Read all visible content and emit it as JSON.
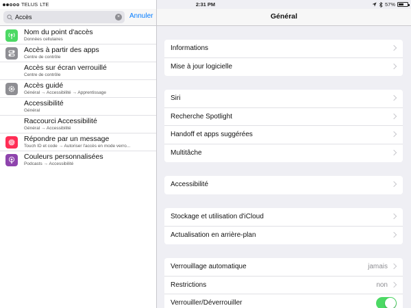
{
  "status": {
    "carrier": "TELUS",
    "network": "LTE",
    "time": "2:31 PM",
    "battery": "57%",
    "battery_level": 0.57
  },
  "search": {
    "value": "Accès",
    "cancel_label": "Annuler",
    "clear_glyph": "×"
  },
  "results": [
    {
      "title": "Nom du point d'accès",
      "subtitle": "Données cellulaires",
      "icon": "hotspot-icon",
      "color": "#4cd964"
    },
    {
      "title": "Accès à partir des apps",
      "subtitle": "Centre de contrôle",
      "icon": "control-center-icon",
      "color": "#8e8e93"
    },
    {
      "title": "Accès sur écran verrouillé",
      "subtitle": "Centre de contrôle",
      "icon": "",
      "color": ""
    },
    {
      "title": "Accès guidé",
      "subtitle": "Général → Accessibilité → Apprentissage",
      "icon": "gear-icon",
      "color": "#8e8e93"
    },
    {
      "title": "Accessibilité",
      "subtitle": "Général",
      "icon": "",
      "color": ""
    },
    {
      "title": "Raccourci Accessibilité",
      "subtitle": "Général → Accessibilité",
      "icon": "",
      "color": ""
    },
    {
      "title": "Répondre par un message",
      "subtitle": "Touch ID et code → Autoriser l'accès en mode verro...",
      "icon": "fingerprint-icon",
      "color": "#ff2d55"
    },
    {
      "title": "Couleurs personnalisées",
      "subtitle": "Podcasts → Accessibilité",
      "icon": "podcasts-icon",
      "color": "#8e44ad"
    }
  ],
  "nav": {
    "title": "Général"
  },
  "groups": [
    {
      "rows": [
        {
          "label": "Informations"
        },
        {
          "label": "Mise à jour logicielle"
        }
      ]
    },
    {
      "rows": [
        {
          "label": "Siri"
        },
        {
          "label": "Recherche Spotlight"
        },
        {
          "label": "Handoff et apps suggérées"
        },
        {
          "label": "Multitâche"
        }
      ]
    },
    {
      "rows": [
        {
          "label": "Accessibilité"
        }
      ]
    },
    {
      "rows": [
        {
          "label": "Stockage et utilisation d'iCloud"
        },
        {
          "label": "Actualisation en arrière-plan"
        }
      ]
    },
    {
      "rows": [
        {
          "label": "Verrouillage automatique",
          "value": "jamais"
        },
        {
          "label": "Restrictions",
          "value": "non"
        },
        {
          "label": "Verrouiller/Déverrouiller",
          "toggle": true
        }
      ]
    }
  ],
  "colors": {
    "accent": "#007aff",
    "toggle_on": "#4cd964"
  }
}
